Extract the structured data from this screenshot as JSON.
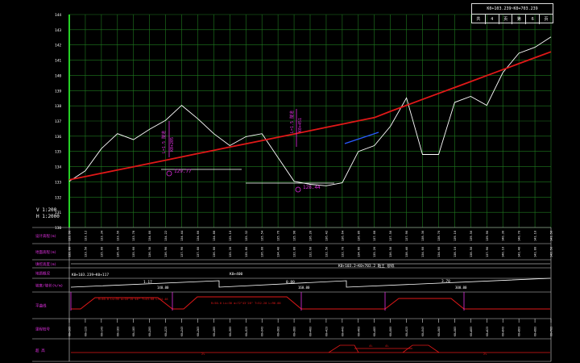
{
  "title_block": {
    "range": "K0+103.239~K0+703.239",
    "sheets": [
      "共",
      "4",
      "页",
      "第",
      "6",
      "页"
    ]
  },
  "scale": {
    "vertical": "V 1:200",
    "horizontal": "H 1:2000"
  },
  "elevation_ticks": [
    "144",
    "143",
    "142",
    "141",
    "140",
    "139",
    "138",
    "137",
    "136",
    "135",
    "134",
    "133",
    "132",
    "131",
    "130"
  ],
  "rows": [
    {
      "label": "设计高程(m)"
    },
    {
      "label": "地面高程(m)"
    },
    {
      "label": "填挖高度(m)"
    },
    {
      "label": "地质概况"
    },
    {
      "label": "坡度/坡长(%/m)"
    },
    {
      "label": "平曲线"
    },
    {
      "label": "里程桩号"
    },
    {
      "label": "超 高"
    }
  ],
  "curve_annotations": [
    {
      "lines": [
        "L=1.5 隧道",
        "K0+205"
      ]
    },
    {
      "lines": [
        "L=1.5 隧道",
        "K0+451"
      ]
    }
  ],
  "elevation_markers": [
    {
      "label": "129.77"
    },
    {
      "label": "128.44"
    }
  ],
  "geology_label": "K0+103.2~K0+703.2 粘土 砂砾",
  "grade_segments": [
    {
      "grade": "1.17",
      "length": "140.00"
    },
    {
      "grade": "0.80",
      "length": "160.00"
    },
    {
      "grade": "3.70",
      "length": "300.00"
    }
  ],
  "grade_top_labels": [
    "K0+103.239~K0+117",
    "K0+400"
  ],
  "curve_labels": [
    "R=40.0 Ls=35 α=18°15'46\" T=43.68 L=74.46",
    "R=50.0 Ls=30 α=72°43'28\" T=52.20 L=96.00"
  ],
  "superelevation_labels": [
    "2%",
    "4%",
    "4%",
    "2%"
  ],
  "chart_data": {
    "type": "line",
    "title": "",
    "xlabel": "",
    "ylabel": "",
    "ylim": [
      129.7,
      144
    ],
    "x": [
      0,
      10,
      20,
      30,
      40,
      50,
      60,
      70,
      80,
      90,
      100,
      110,
      120,
      130,
      140,
      150,
      160,
      170,
      180,
      190,
      200,
      210,
      220,
      230,
      240,
      250,
      260,
      270,
      280,
      290,
      300
    ],
    "series": [
      {
        "name": "ground",
        "color": "#ffffff",
        "values": [
          132.8,
          133.5,
          135.0,
          136.0,
          135.6,
          136.3,
          136.9,
          137.9,
          137.0,
          136.0,
          135.2,
          135.8,
          136.0,
          134.4,
          132.8,
          132.6,
          132.5,
          132.7,
          134.8,
          135.2,
          136.5,
          138.4,
          134.6,
          134.6,
          138.1,
          138.5,
          137.9,
          140.1,
          141.4,
          141.8,
          142.5
        ]
      },
      {
        "name": "design",
        "color": "#e01818",
        "values": [
          132.9,
          133.12,
          133.34,
          133.56,
          133.78,
          134.0,
          134.22,
          134.44,
          134.66,
          134.88,
          135.1,
          135.32,
          135.54,
          135.76,
          135.98,
          136.2,
          136.42,
          136.64,
          136.86,
          137.08,
          137.5,
          137.9,
          138.3,
          138.7,
          139.1,
          139.5,
          139.9,
          140.3,
          140.7,
          141.1,
          141.5
        ]
      }
    ]
  }
}
